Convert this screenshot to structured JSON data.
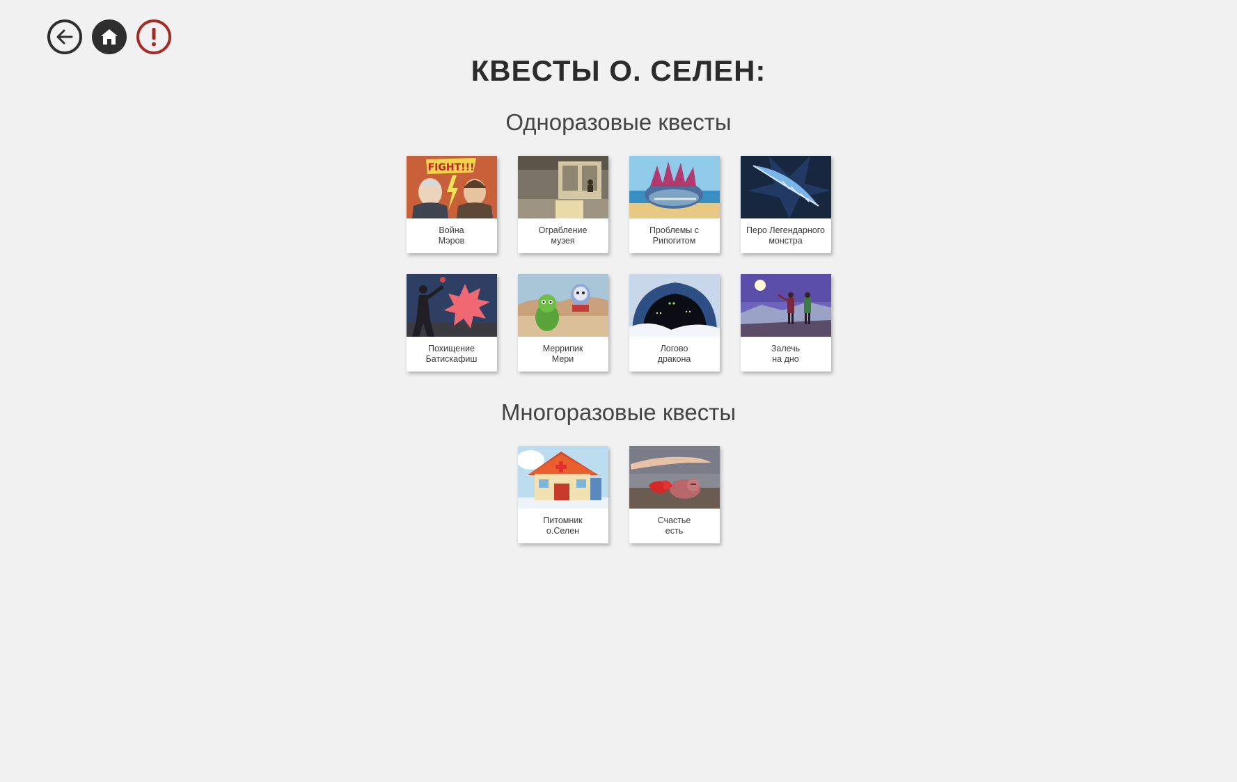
{
  "nav": {
    "back_icon": "arrow-left-icon",
    "home_icon": "home-icon",
    "report_icon": "exclamation-icon",
    "report_color": "#a52a24"
  },
  "page": {
    "title": "КВЕСТЫ О. СЕЛЕН:"
  },
  "sections": {
    "one_time": {
      "title": "Одноразовые квесты",
      "quests": [
        {
          "line1": "Война",
          "line2": "Мэров"
        },
        {
          "line1": "Ограбление",
          "line2": "музея"
        },
        {
          "line1": "Проблемы с",
          "line2": "Рипогитом"
        },
        {
          "line1": "Перо Легендарного",
          "line2": "монстра"
        },
        {
          "line1": "Похищение",
          "line2": "Батискафиш"
        },
        {
          "line1": "Меррипик",
          "line2": "Мери"
        },
        {
          "line1": "Логово",
          "line2": "дракона"
        },
        {
          "line1": "Залечь",
          "line2": "на дно"
        }
      ]
    },
    "reusable": {
      "title": "Многоразовые квесты",
      "quests": [
        {
          "line1": "Питомник",
          "line2": "о.Селен"
        },
        {
          "line1": "Счастье",
          "line2": "есть"
        }
      ]
    }
  }
}
